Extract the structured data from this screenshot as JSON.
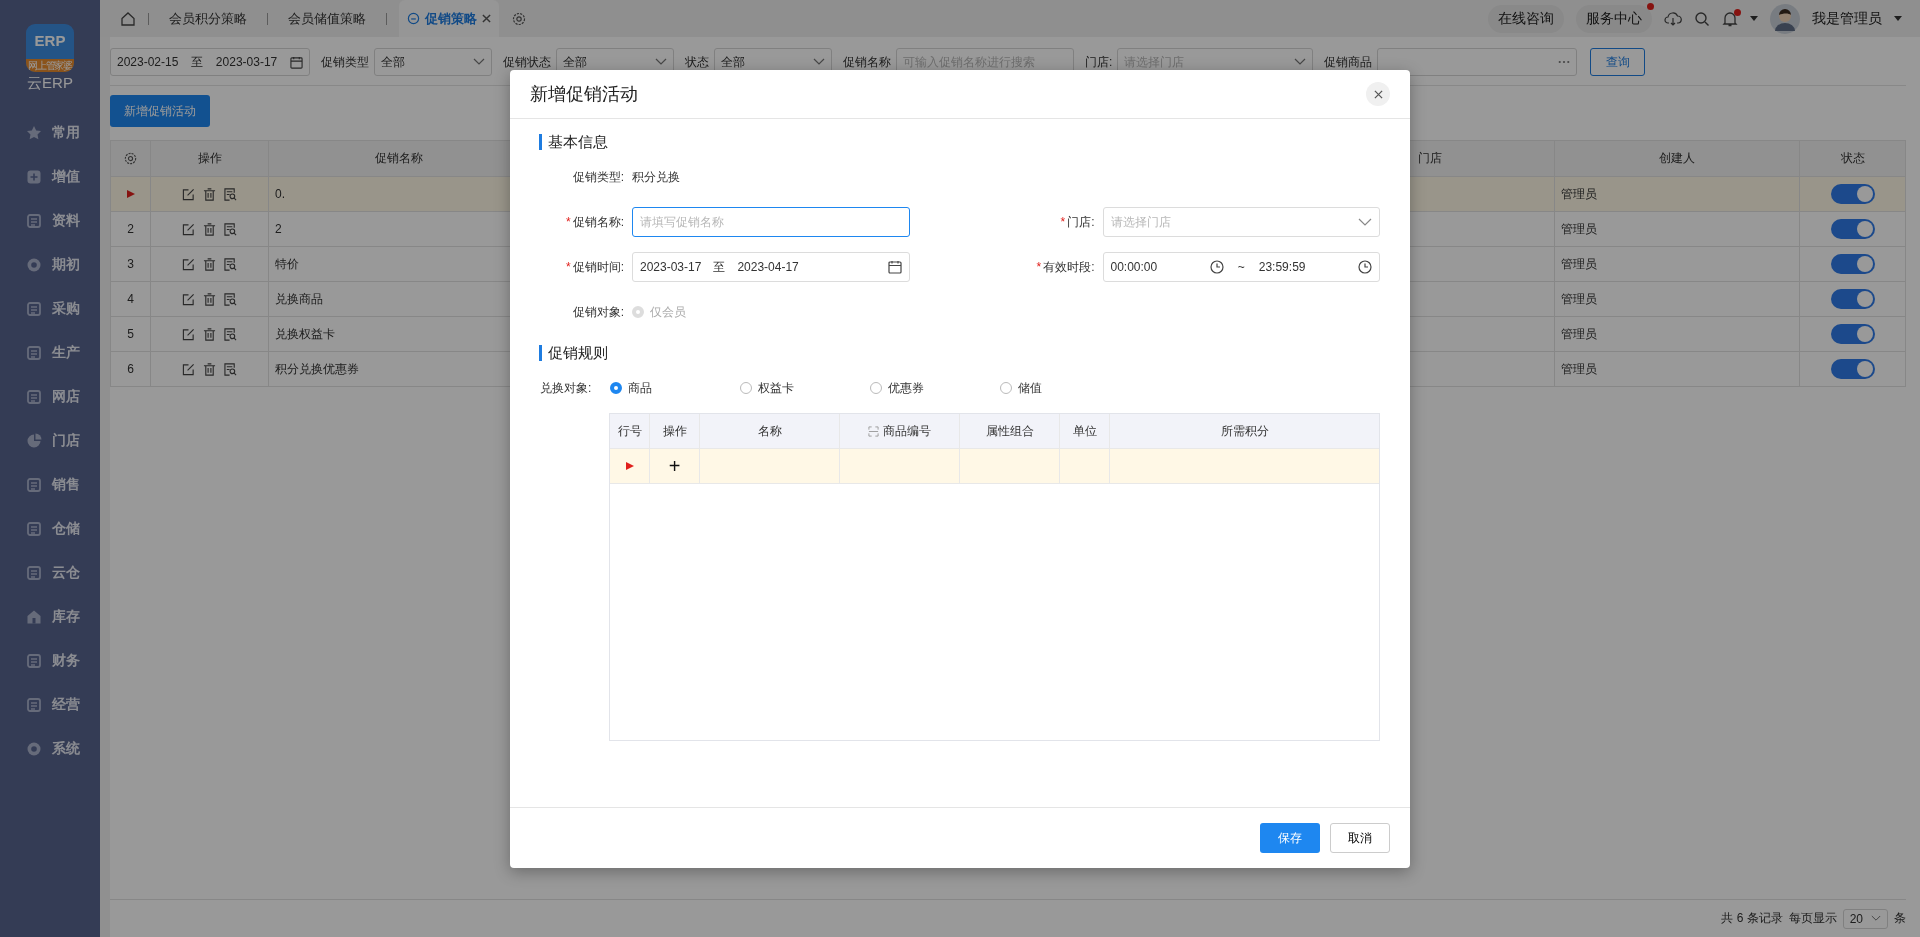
{
  "logo": {
    "mark": "ERP",
    "band": "网上管家婆",
    "label": "云ERP"
  },
  "sidebar": {
    "items": [
      {
        "label": "常用"
      },
      {
        "label": "增值"
      },
      {
        "label": "资料"
      },
      {
        "label": "期初"
      },
      {
        "label": "采购"
      },
      {
        "label": "生产"
      },
      {
        "label": "网店"
      },
      {
        "label": "门店"
      },
      {
        "label": "销售"
      },
      {
        "label": "仓储"
      },
      {
        "label": "云仓"
      },
      {
        "label": "库存"
      },
      {
        "label": "财务"
      },
      {
        "label": "经营"
      },
      {
        "label": "系统"
      }
    ]
  },
  "tabs": [
    {
      "label": "会员积分策略",
      "selected": false,
      "closable": false
    },
    {
      "label": "会员储值策略",
      "selected": false,
      "closable": false
    },
    {
      "label": "促销策略",
      "selected": true,
      "closable": true
    }
  ],
  "header": {
    "consult": "在线咨询",
    "service": "服务中心",
    "service_badge": true,
    "bell_badge": true,
    "user": "我是管理员"
  },
  "filters": {
    "date_from": "2023-02-15",
    "date_sep": "至",
    "date_to": "2023-03-17",
    "type_label": "促销类型",
    "type_value": "全部",
    "status_label": "促销状态",
    "status_value": "全部",
    "state_label": "状态",
    "state_value": "全部",
    "name_label": "促销名称",
    "name_placeholder": "可输入促销名称进行搜索",
    "store_label": "门店:",
    "store_placeholder": "请选择门店",
    "goods_label": "促销商品",
    "query": "查询"
  },
  "add_button": "新增促销活动",
  "table": {
    "columns": [
      "操作",
      "促销名称",
      "门店",
      "创建人",
      "状态"
    ],
    "rows": [
      {
        "selected": true,
        "name": "0.",
        "creator": "管理员",
        "on": true
      },
      {
        "selected": false,
        "no": "2",
        "name": "2",
        "creator": "管理员",
        "on": true
      },
      {
        "selected": false,
        "no": "3",
        "name": "特价",
        "creator": "管理员",
        "on": true
      },
      {
        "selected": false,
        "no": "4",
        "name": "兑换商品",
        "creator": "管理员",
        "on": true
      },
      {
        "selected": false,
        "no": "5",
        "name": "兑换权益卡",
        "creator": "管理员",
        "on": true
      },
      {
        "selected": false,
        "no": "6",
        "name": "积分兑换优惠券",
        "creator": "管理员",
        "on": true
      }
    ]
  },
  "pager": {
    "total": "共 6 条记录",
    "per_page_label": "每页显示",
    "per_page": "20",
    "unit": "条"
  },
  "dialog": {
    "title": "新增促销活动",
    "basic_title": "基本信息",
    "type_label": "促销类型:",
    "type_value": "积分兑换",
    "name_label": "促销名称:",
    "name_placeholder": "请填写促销名称",
    "name_mark": "*",
    "store_label": "门店:",
    "store_placeholder": "请选择门店",
    "store_mark": "*",
    "time_label": "促销时间:",
    "time_from": "2023-03-17",
    "time_sep": "至",
    "time_to": "2023-04-17",
    "time_mark": "*",
    "period_label": "有效时段:",
    "period_from": "00:00:00",
    "period_sep": "~",
    "period_to": "23:59:59",
    "period_mark": "*",
    "target_label": "促销对象:",
    "target_options": [
      {
        "label": "仅会员",
        "selected": true,
        "disabled": true
      }
    ],
    "rules_title": "促销规则",
    "exchange_label": "兑换对象:",
    "exchange_options": [
      {
        "label": "商品",
        "selected": true
      },
      {
        "label": "权益卡",
        "selected": false
      },
      {
        "label": "优惠券",
        "selected": false
      },
      {
        "label": "储值",
        "selected": false
      }
    ],
    "grid": {
      "columns": [
        "行号",
        "操作",
        "名称",
        "商品编号",
        "属性组合",
        "单位",
        "所需积分"
      ],
      "rows": [
        {
          "selected": true,
          "add": "+"
        }
      ]
    },
    "save": "保存",
    "cancel": "取消"
  }
}
